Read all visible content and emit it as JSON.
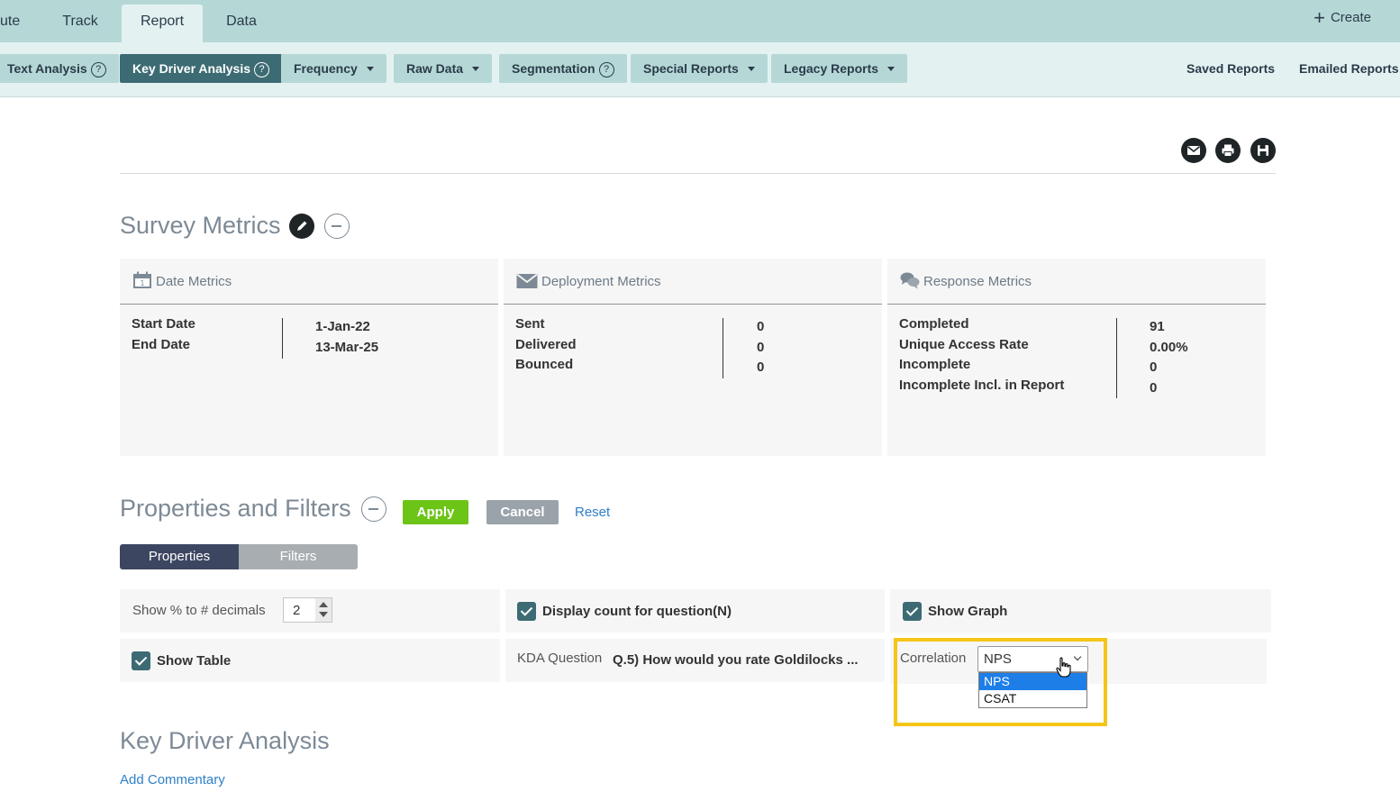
{
  "topnav": {
    "tabs": [
      {
        "label": "ute"
      },
      {
        "label": "Track"
      },
      {
        "label": "Report"
      },
      {
        "label": "Data"
      }
    ],
    "create_label": "Create"
  },
  "subnav": {
    "pills": [
      {
        "label": "Text Analysis"
      },
      {
        "label": "Key Driver Analysis"
      },
      {
        "label": "Frequency"
      },
      {
        "label": "Raw Data"
      },
      {
        "label": "Segmentation"
      },
      {
        "label": "Special Reports"
      },
      {
        "label": "Legacy Reports"
      }
    ],
    "saved_reports": "Saved Reports",
    "emailed_reports": "Emailed Reports"
  },
  "toolbar_icons": [
    "email-icon",
    "print-icon",
    "save-icon"
  ],
  "survey_metrics": {
    "title": "Survey Metrics",
    "date": {
      "header": "Date Metrics",
      "labels": [
        "Start Date",
        "End Date"
      ],
      "values": [
        "1-Jan-22",
        "13-Mar-25"
      ]
    },
    "deployment": {
      "header": "Deployment Metrics",
      "labels": [
        "Sent",
        "Delivered",
        "Bounced"
      ],
      "values": [
        "0",
        "0",
        "0"
      ]
    },
    "response": {
      "header": "Response Metrics",
      "labels": [
        "Completed",
        "Unique Access Rate",
        "Incomplete",
        "Incomplete Incl. in Report"
      ],
      "values": [
        "91",
        "0.00%",
        "0",
        "0"
      ]
    }
  },
  "properties": {
    "title": "Properties and Filters",
    "apply": "Apply",
    "cancel": "Cancel",
    "reset": "Reset",
    "tabs": {
      "properties": "Properties",
      "filters": "Filters"
    },
    "decimals_label": "Show % to # decimals",
    "decimals_value": "2",
    "display_count": "Display count for question(N)",
    "show_graph": "Show Graph",
    "show_table": "Show Table",
    "kda_question_label": "KDA Question",
    "kda_question_value": "Q.5) How would you rate Goldilocks ...",
    "correlation_label": "Correlation",
    "correlation_value": "NPS",
    "correlation_options": [
      "NPS",
      "CSAT"
    ]
  },
  "kda": {
    "title": "Key Driver Analysis",
    "add_commentary": "Add Commentary"
  },
  "colors": {
    "topnav_bg": "#b5d8d7",
    "subnav_bg": "#e3f2f1",
    "active_pill": "#3d6b73",
    "apply_green": "#6cc417",
    "highlight": "#f5c518",
    "link_blue": "#2f80c8"
  }
}
